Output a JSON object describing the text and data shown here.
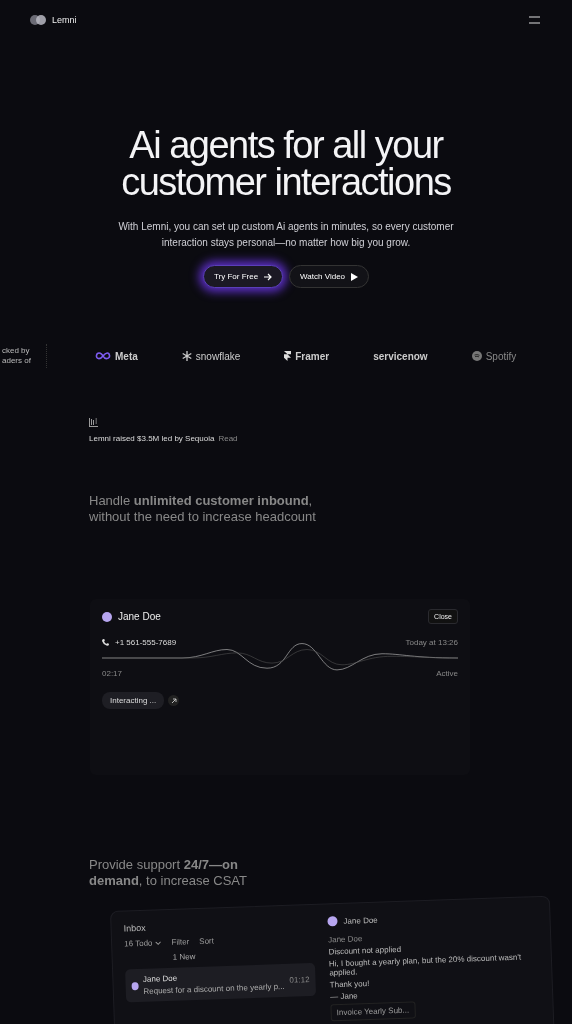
{
  "nav": {
    "brand": "Lemni"
  },
  "hero": {
    "title": "Ai agents for all your customer interactions",
    "subtitle": "With Lemni, you can set up custom Ai agents in minutes, so every customer interaction stays personal—no matter how big you grow.",
    "buttons": [
      {
        "label": "Try For Free",
        "kind": "primary"
      },
      {
        "label": "Watch Video",
        "kind": "secondary"
      }
    ]
  },
  "backers": {
    "caption": [
      "cked by",
      "aders of"
    ],
    "logos": [
      {
        "name": "Meta",
        "kind": "meta"
      },
      {
        "name": "snowflake",
        "kind": "snowflake"
      },
      {
        "name": "Framer",
        "kind": "framer"
      },
      {
        "name": "servicenow",
        "kind": "servicenow"
      },
      {
        "name": "Spotify",
        "kind": "spotify"
      }
    ]
  },
  "news": {
    "text": "Lemni raised $3.5M led by Sequoia",
    "link": "Read"
  },
  "section1": {
    "heading": "Handle **unlimited customer inbound**,",
    "subheading": "without the need to increase headcount"
  },
  "call": {
    "name": "Jane Doe",
    "close": "Close",
    "phone": "+1 561-555-7689",
    "time": "Today at 13:26",
    "duration": "02:17",
    "status": "Active",
    "chip": "Interacting ..."
  },
  "section2": {
    "heading": "Provide support **24/7—on demand**, to increase CSAT"
  },
  "inbox": {
    "title": "Inbox",
    "todo": "16 Todo",
    "filter": "Filter",
    "sort": "Sort",
    "new": "1 New",
    "items": [
      {
        "name": "Jane Doe",
        "preview": "Request for a discount on the yearly p...",
        "time": "01:12",
        "selected": true
      }
    ],
    "contact": "Jane Doe",
    "sender": "Jane Doe",
    "subject": "Discount not applied",
    "body": "Hi, I bought a yearly plan, but the 20% discount wasn't applied.",
    "thanks": "Thank you!",
    "sign": "— Jane",
    "attachment": "Invoice Yearly Sub..."
  }
}
